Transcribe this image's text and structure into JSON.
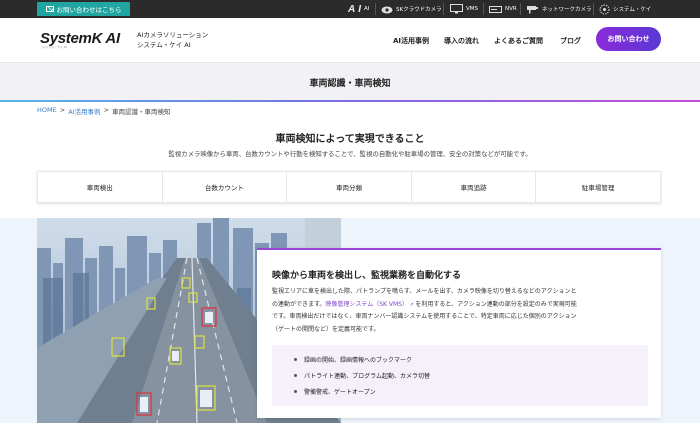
{
  "topbar": {
    "contact_label": "お問い合わせはこちら",
    "products": [
      {
        "label": "AI",
        "icon": "ai-logo-icon"
      },
      {
        "label": "SKクラウドカメラ",
        "icon": "cloud-camera-icon"
      },
      {
        "label": "VMS",
        "icon": "vms-monitor-icon"
      },
      {
        "label": "NVR",
        "icon": "nvr-recorder-icon"
      },
      {
        "label": "ネットワークカメラ",
        "icon": "network-camera-icon"
      },
      {
        "label": "システム・ケイ",
        "icon": "system-k-logo-icon"
      }
    ]
  },
  "header": {
    "logo": "SystemK AI",
    "logo_sub": "システム・ケイ AI",
    "tagline1": "AIカメラソリューション",
    "tagline2": "システム・ケイ AI",
    "nav": [
      "AI活用事例",
      "導入の流れ",
      "よくあるご質問",
      "ブログ"
    ],
    "cta": "お問い合わせ"
  },
  "page": {
    "title": "車両認識・車両検知",
    "breadcrumb": {
      "home": "HOME",
      "sep": ">",
      "cases": "AI活用事例",
      "current": "車両認識・車両検知"
    }
  },
  "intro": {
    "heading": "車両検知によって実現できること",
    "lead": "監視カメラ映像から車両、台数カウントや行動を検知することで、監視の自動化や駐車場の管理、安全の対策などが可能です。"
  },
  "tabs": [
    "車両検出",
    "台数カウント",
    "車両分類",
    "車両追跡",
    "駐車場管理"
  ],
  "feature": {
    "heading": "映像から車両を検出し、監視業務を自動化する",
    "para1": "監視エリアに車を検出した際、パトランプを鳴らす、メールを出す、カメラ映像を切り替えるなどのアクションと",
    "para2_pre": "の連動ができます。",
    "para2_link": "映像管理システム（SK VMS）",
    "para2_post": "を利用すると、アクション連動の部分を設定のみで実現可能",
    "para3": "です。車両検出だけではなく、車両ナンバー認識システムを使用することで、特定車両に応じた個別のアクション",
    "para4": "（ゲートの開閉など）を定義可能です。",
    "bullets": [
      "録画の開始、録画情報へのブックマーク",
      "パトライト連動、プログラム起動、カメラ切替",
      "警備警戒、ゲートオープン"
    ]
  },
  "colors": {
    "accent": "#8b2bd8",
    "contact": "#1fa6a0",
    "topbar": "#2b2b2b"
  }
}
